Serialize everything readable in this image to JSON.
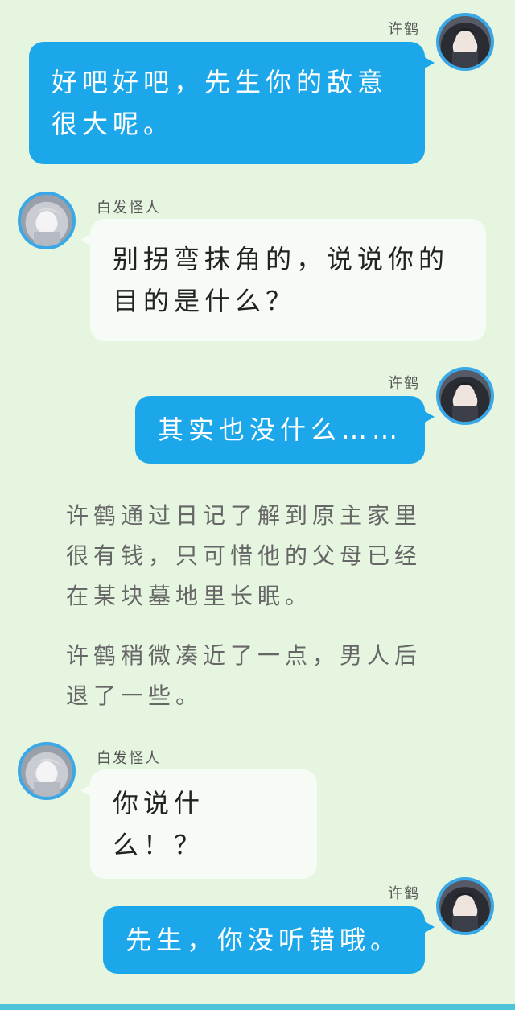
{
  "messages": [
    {
      "speaker": "许鹤",
      "text": "好吧好吧，先生你的敌意很大呢。"
    },
    {
      "speaker": "白发怪人",
      "text": "别拐弯抹角的，说说你的目的是什么？"
    },
    {
      "speaker": "许鹤",
      "text": "其实也没什么……"
    },
    {
      "speaker": "白发怪人",
      "text": "你说什么！？"
    },
    {
      "speaker": "许鹤",
      "text": "先生，你没听错哦。"
    }
  ],
  "narration": [
    "许鹤通过日记了解到原主家里很有钱，只可惜他的父母已经在某块墓地里长眠。",
    "许鹤稍微凑近了一点，男人后退了一些。"
  ],
  "colors": {
    "background": "#e6f5e0",
    "blue_bubble": "#1ba7ea",
    "white_bubble": "#f7fbf5",
    "avatar_ring": "#3aa8e6"
  },
  "icons": {
    "xuhe_avatar": "dark-haired-man-avatar",
    "baifa_avatar": "white-haired-man-avatar"
  }
}
